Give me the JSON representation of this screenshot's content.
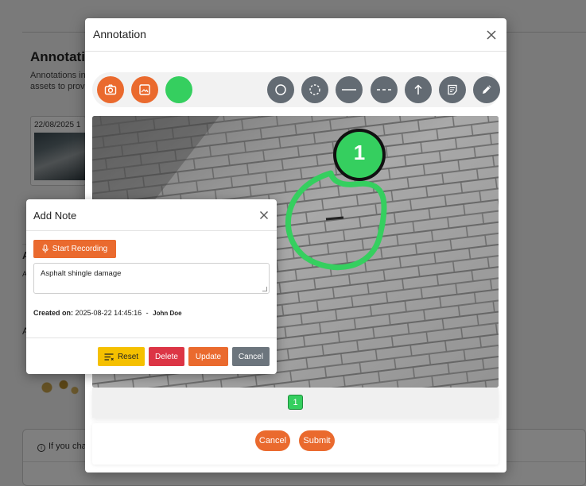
{
  "background": {
    "title": "Annotatio",
    "description_line1": "Annotations in",
    "description_line2": "assets to provi",
    "card_date": "22/08/2025 1",
    "section_letter_1": "A",
    "section_letter_2": "A",
    "section_letter_3": "A",
    "lower_notice": "If you cha"
  },
  "modal": {
    "title": "Annotation",
    "toolbar": {
      "tools": [
        "camera-icon",
        "image-icon",
        "color-swatch",
        "circle-icon",
        "dashed-circle-icon",
        "solid-line-icon",
        "dashed-line-icon",
        "arrow-up-icon",
        "note-icon",
        "pencil-icon"
      ]
    },
    "marker_number": "1",
    "page_indicator": "1",
    "cancel_label": "Cancel",
    "submit_label": "Submit"
  },
  "note": {
    "title": "Add Note",
    "record_label": "Start Recording",
    "text": "Asphalt shingle damage",
    "created_label": "Created on:",
    "created_value": "2025-08-22 14:45:16",
    "separator": "-",
    "author": "John Doe",
    "reset_label": "Reset",
    "delete_label": "Delete",
    "update_label": "Update",
    "cancel_label": "Cancel"
  },
  "colors": {
    "accent": "#ea6a2e",
    "annotation_green": "#35cf5f",
    "tool_gray": "#636b73",
    "reset_yellow": "#f5c000",
    "delete_red": "#dc3545",
    "cancel_gray": "#6c757d"
  }
}
